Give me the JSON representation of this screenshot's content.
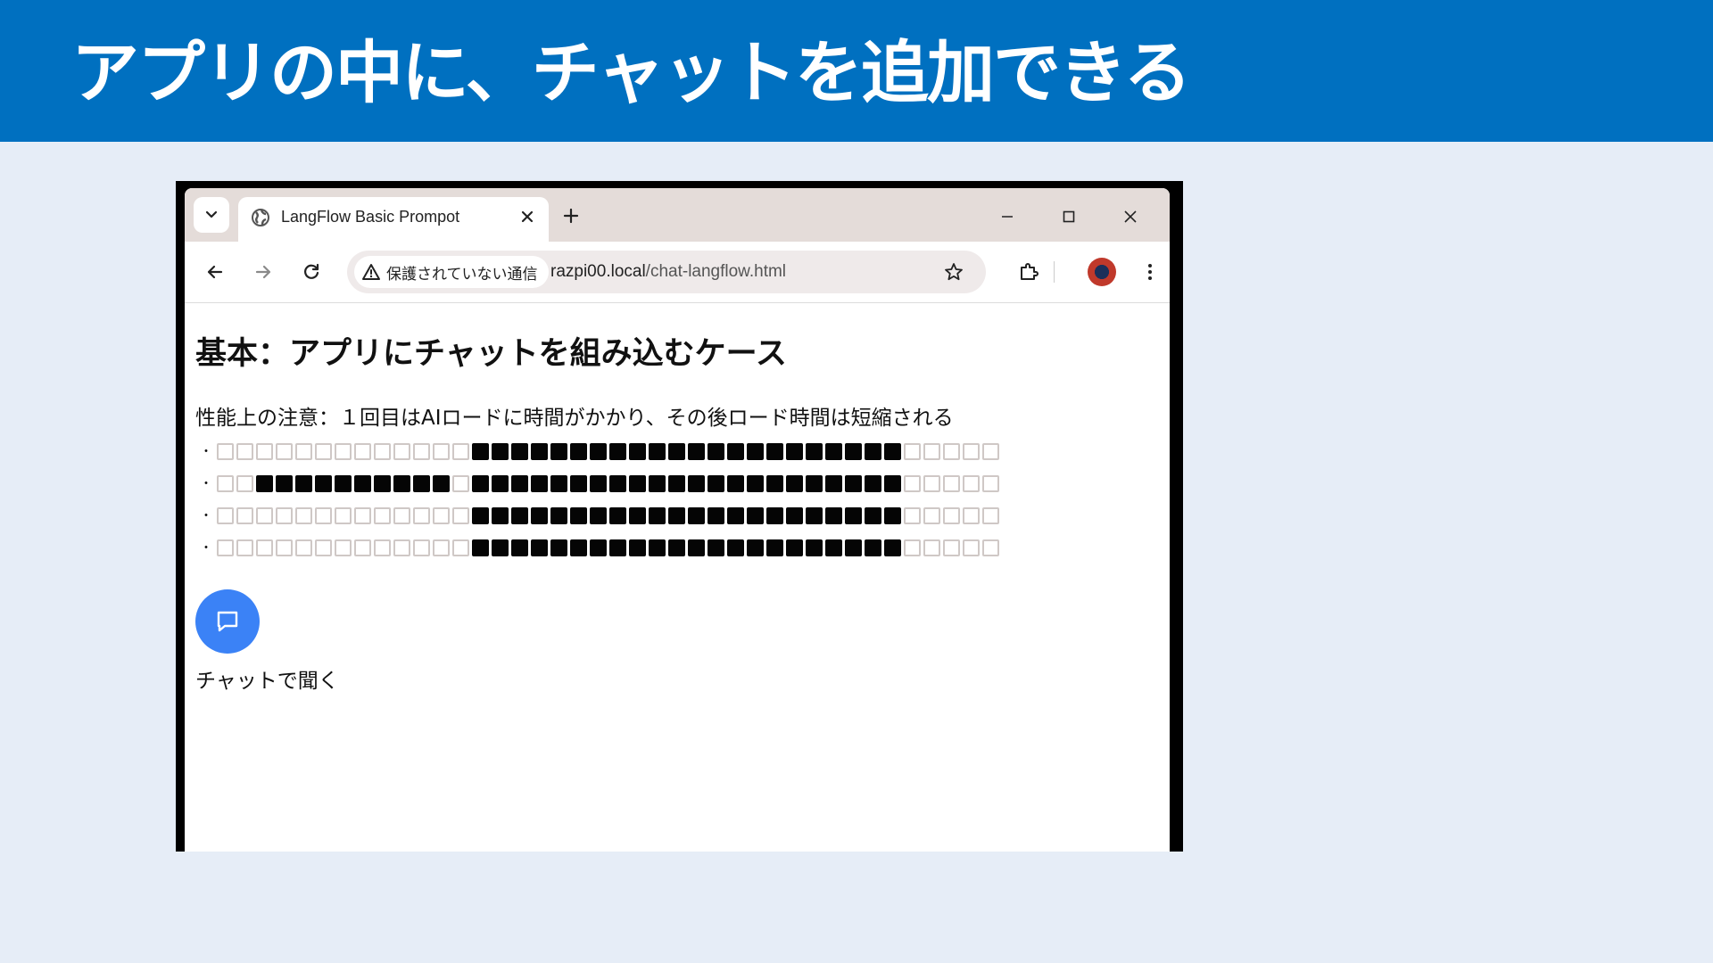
{
  "slide": {
    "title": "アプリの中に、チャットを追加できる"
  },
  "browser": {
    "tab_title": "LangFlow Basic Prompot",
    "security_label": "保護されていない通信",
    "url_host": "razpi00.local",
    "url_path": "/chat-langflow.html"
  },
  "page": {
    "heading": "基本：アプリにチャットを組み込むケース",
    "note": "性能上の注意：１回目はAIロードに時間がかかり、その後ロード時間は短縮される",
    "bullet_symbol": "・",
    "bullets": [
      "□□□□□□□□□□□□□■■■■■■■■■■■■■■■■■■■■■■□□□□□",
      "□□■■■■■■■■■■□■■■■■■■■■■■■■■■■■■■■■■□□□□□",
      "□□□□□□□□□□□□□■■■■■■■■■■■■■■■■■■■■■■□□□□□",
      "□□□□□□□□□□□□□■■■■■■■■■■■■■■■■■■■■■■□□□□□"
    ],
    "chat_label": "チャットで聞く"
  },
  "icons": {
    "tab_search": "chevron-down-icon",
    "tab_favicon": "globe-icon",
    "tab_close": "close-icon",
    "new_tab": "plus-icon",
    "minimize": "minimize-icon",
    "maximize": "maximize-icon",
    "close_window": "close-icon",
    "back": "back-arrow-icon",
    "forward": "forward-arrow-icon",
    "reload": "reload-icon",
    "warning": "warning-icon",
    "bookmark": "star-icon",
    "extensions": "puzzle-icon",
    "menu": "more-vert-icon",
    "chat": "chat-bubble-icon"
  },
  "colors": {
    "slide_header": "#0070c0",
    "slide_background": "#e6edf7",
    "chat_button": "#3b82f6"
  }
}
